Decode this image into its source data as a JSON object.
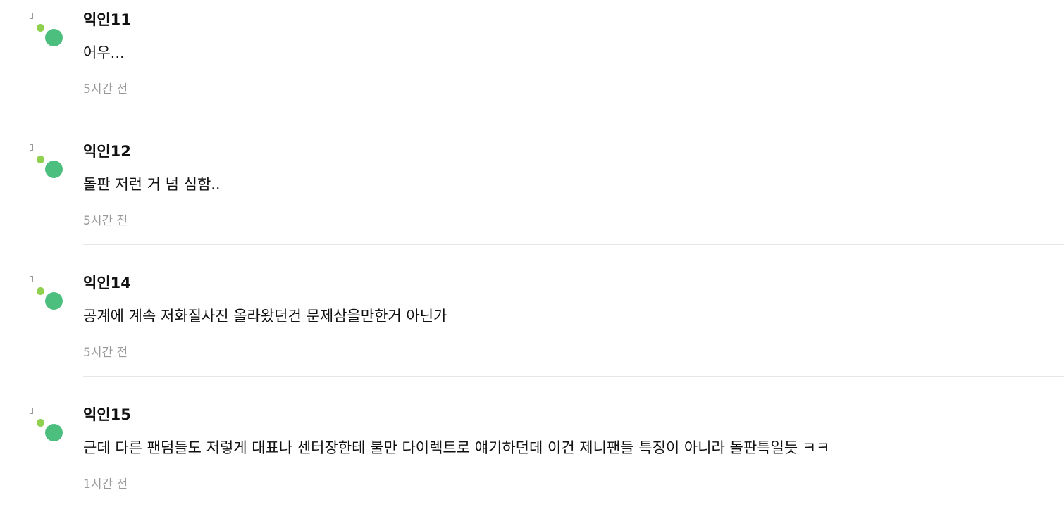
{
  "comments": [
    {
      "author": "익인11",
      "text": "어우...",
      "time": "5시간 전"
    },
    {
      "author": "익인12",
      "text": "돌판 저런 거 넘 심함..",
      "time": "5시간 전"
    },
    {
      "author": "익인14",
      "text": "공계에 계속 저화질사진 올라왔던건 문제삼을만한거 아닌가",
      "time": "5시간 전"
    },
    {
      "author": "익인15",
      "text": "근데 다른 팬덤들도 저렇게 대표나 센터장한테 불만 다이렉트로 얘기하던데 이건 제니팬들 특징이 아니라 돌판특일듯 ㅋㅋ",
      "time": "1시간 전"
    }
  ],
  "colors": {
    "avatar_small_dot": "#8fd14f",
    "avatar_big_dot": "#4cbf7f",
    "time_text": "#999999",
    "divider": "#e6e6e6"
  },
  "icons": {
    "avatar": "avatar-icon"
  }
}
